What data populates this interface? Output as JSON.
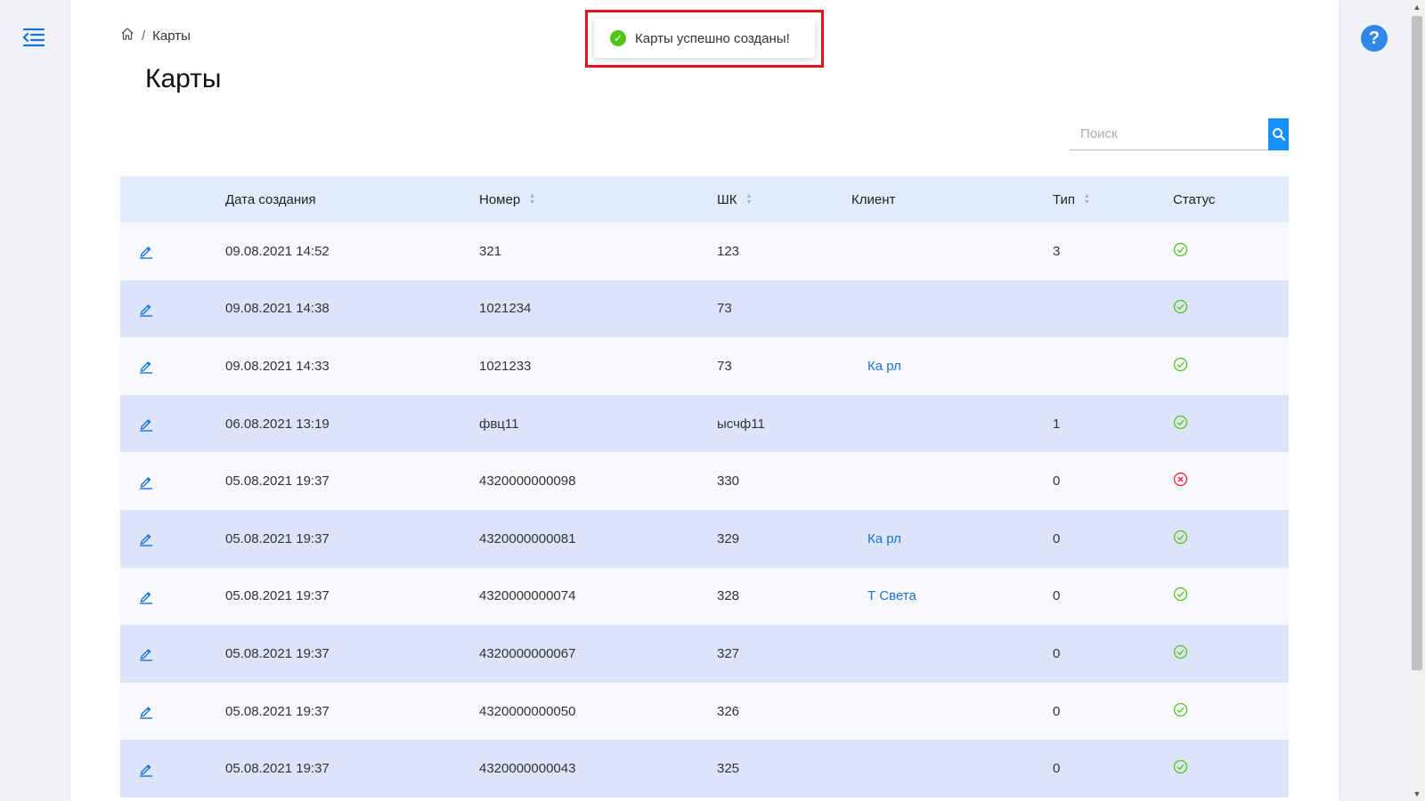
{
  "breadcrumb": {
    "current": "Карты"
  },
  "page": {
    "title": "Карты"
  },
  "toast": {
    "message": "Карты успешно созданы!"
  },
  "search": {
    "placeholder": "Поиск",
    "value": ""
  },
  "help": {
    "label": "?"
  },
  "table": {
    "headers": {
      "date": "Дата создания",
      "number": "Номер",
      "barcode": "ШК",
      "client": "Клиент",
      "type": "Тип",
      "status": "Статус"
    },
    "rows": [
      {
        "date": "09.08.2021 14:52",
        "number": "321",
        "barcode": "123",
        "client": "",
        "type": "3",
        "status": "active"
      },
      {
        "date": "09.08.2021 14:38",
        "number": "1021234",
        "barcode": "73",
        "client": "",
        "type": "",
        "status": "active"
      },
      {
        "date": "09.08.2021 14:33",
        "number": "1021233",
        "barcode": "73",
        "client": "Ка рл",
        "type": "",
        "status": "active"
      },
      {
        "date": "06.08.2021 13:19",
        "number": "фвц11",
        "barcode": "ысчф11",
        "client": "",
        "type": "1",
        "status": "active"
      },
      {
        "date": "05.08.2021 19:37",
        "number": "4320000000098",
        "barcode": "330",
        "client": "",
        "type": "0",
        "status": "inactive"
      },
      {
        "date": "05.08.2021 19:37",
        "number": "4320000000081",
        "barcode": "329",
        "client": "Ка рл",
        "type": "0",
        "status": "active"
      },
      {
        "date": "05.08.2021 19:37",
        "number": "4320000000074",
        "barcode": "328",
        "client": "Т Света",
        "type": "0",
        "status": "active"
      },
      {
        "date": "05.08.2021 19:37",
        "number": "4320000000067",
        "barcode": "327",
        "client": "",
        "type": "0",
        "status": "active"
      },
      {
        "date": "05.08.2021 19:37",
        "number": "4320000000050",
        "barcode": "326",
        "client": "",
        "type": "0",
        "status": "active"
      },
      {
        "date": "05.08.2021 19:37",
        "number": "4320000000043",
        "barcode": "325",
        "client": "",
        "type": "0",
        "status": "active"
      }
    ]
  },
  "colors": {
    "accent": "#1890ff",
    "active": "#52c41a",
    "inactive": "#f5222d",
    "row_alt": "#dce4fa",
    "header_bg": "#e0ecfb"
  },
  "icons": {
    "menu": "menu-fold-icon",
    "home": "home-icon",
    "edit": "edit-icon",
    "search": "search-icon",
    "ok": "check-circle-icon",
    "error": "close-circle-icon"
  }
}
